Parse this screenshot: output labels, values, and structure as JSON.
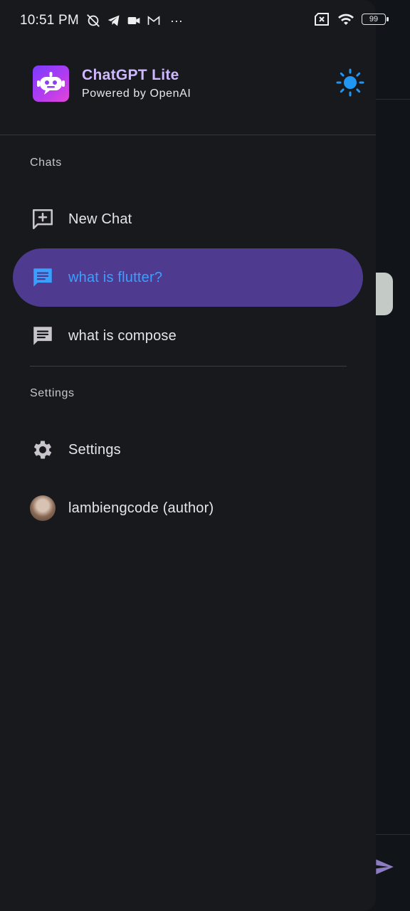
{
  "status_bar": {
    "time": "10:51 PM",
    "more": "···",
    "battery": "99"
  },
  "app": {
    "title": "ChatGPT Lite",
    "subtitle": "Powered by OpenAI"
  },
  "sections": {
    "chats_label": "Chats",
    "settings_label": "Settings"
  },
  "chats": {
    "new_chat": "New Chat",
    "items": [
      {
        "label": "what is flutter?",
        "selected": true
      },
      {
        "label": "what is compose",
        "selected": false
      }
    ]
  },
  "settings": {
    "settings_item": "Settings",
    "author_item": "lambiengcode (author)"
  },
  "colors": {
    "accent": "#4e3a8e",
    "selected_text": "#3aa0ff",
    "title": "#cfb8ff",
    "sun": "#2196f3"
  }
}
